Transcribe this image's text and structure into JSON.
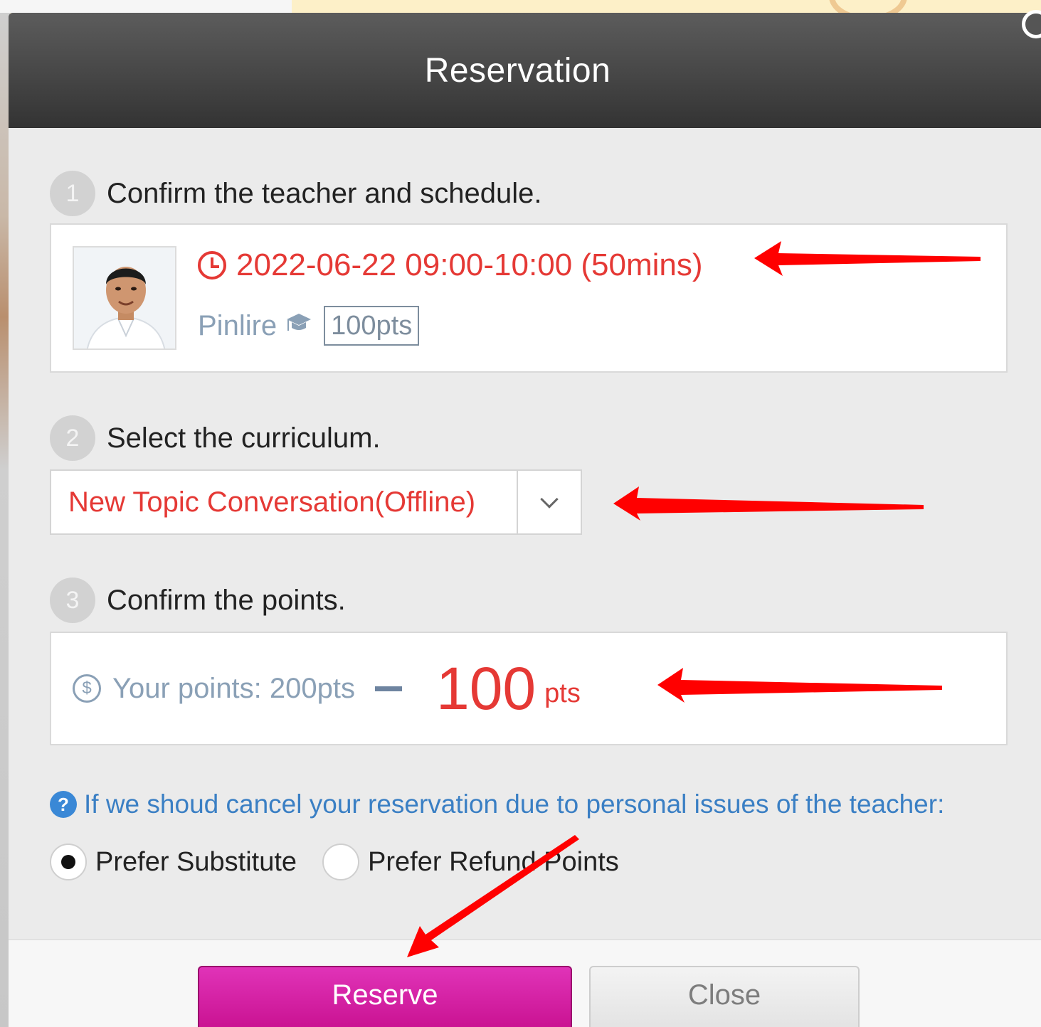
{
  "dialog": {
    "title": "Reservation"
  },
  "steps": [
    {
      "number": "1",
      "text": "Confirm the teacher and schedule."
    },
    {
      "number": "2",
      "text": "Select the curriculum."
    },
    {
      "number": "3",
      "text": "Confirm the points."
    }
  ],
  "schedule": {
    "datetime": "2022-06-22 09:00-10:00 (50mins)",
    "teacher_name": "Pinlire",
    "price": "100pts"
  },
  "curriculum": {
    "selected": "New Topic Conversation(Offline)"
  },
  "points": {
    "current": "Your points: 200pts",
    "cost": "100",
    "unit": "pts",
    "coin_symbol": "$"
  },
  "cancellation": {
    "help_symbol": "?",
    "notice": "If we shoud cancel your reservation due to personal issues of the teacher:",
    "options": [
      {
        "label": "Prefer Substitute",
        "selected": true
      },
      {
        "label": "Prefer Refund Points",
        "selected": false
      }
    ]
  },
  "buttons": {
    "reserve": "Reserve",
    "close": "Close"
  },
  "colors": {
    "accent_red": "#e53935",
    "reserve_magenta": "#d41ca3",
    "link_blue": "#3a7fc4",
    "header_dark": "#444444",
    "annotation_arrow": "#ff0000"
  },
  "icons": {
    "schedule": "clock-icon",
    "teacher_level": "graduation-cap-icon",
    "points": "coin-icon",
    "notice": "help-circle-icon",
    "dropdown": "chevron-down-icon"
  }
}
